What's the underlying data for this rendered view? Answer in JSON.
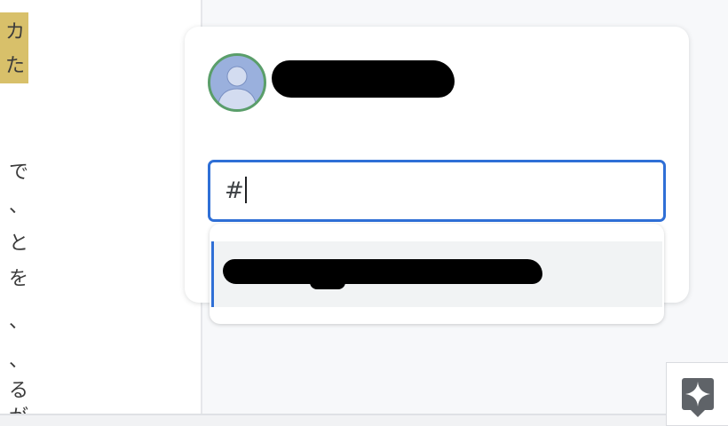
{
  "document": {
    "highlighted_chars": [
      "カ",
      "た"
    ],
    "chars": [
      "で",
      "、",
      "と",
      "を",
      "、",
      "、",
      "る",
      "が"
    ]
  },
  "comment": {
    "input_value": "#",
    "author_name": ""
  },
  "suggestions": [
    {
      "label": ""
    }
  ],
  "icons": {
    "avatar": "person-icon",
    "fab": "sparkle-icon"
  },
  "colors": {
    "accent": "#2f6fd6",
    "highlight": "#d8c06a",
    "avatar_ring": "#5a9e6a"
  }
}
